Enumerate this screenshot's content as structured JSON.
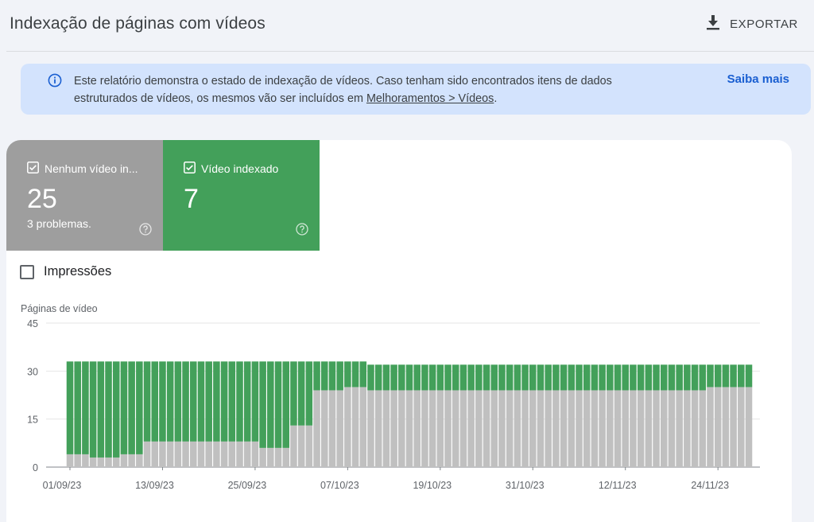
{
  "header": {
    "title": "Indexação de páginas com vídeos",
    "export_label": "EXPORTAR",
    "export_icon": "download-icon"
  },
  "info_banner": {
    "text_before": "Este relatório demonstra o estado de indexação de vídeos. Caso tenham sido encontrados itens de dados estruturados de vídeos, os mesmos vão ser incluídos em ",
    "link_text": "Melhoramentos > Vídeos",
    "text_after": ".",
    "learn_more": "Saiba mais",
    "icon": "info-icon"
  },
  "tiles": [
    {
      "label": "Nenhum vídeo in...",
      "value": "25",
      "subtext": "3 problemas.",
      "color": "#9e9e9e",
      "checked": true
    },
    {
      "label": "Vídeo indexado",
      "value": "7",
      "subtext": "",
      "color": "#43a05a",
      "checked": true
    }
  ],
  "impressions": {
    "label": "Impressões",
    "checked": false
  },
  "chart_data": {
    "type": "bar",
    "stacked": true,
    "ylabel": "Páginas de vídeo",
    "ylim": [
      0,
      45
    ],
    "yticks": [
      "0",
      "15",
      "30",
      "45"
    ],
    "x_tick_labels": [
      "01/09/23",
      "13/09/23",
      "25/09/23",
      "07/10/23",
      "19/10/23",
      "31/10/23",
      "12/11/23",
      "24/11/23"
    ],
    "x_tick_index": [
      0,
      12,
      24,
      36,
      48,
      60,
      72,
      84
    ],
    "categories_count": 88,
    "series": [
      {
        "name": "Nenhum vídeo in...",
        "color": "#c0c0c0",
        "values": [
          4,
          4,
          4,
          3,
          3,
          3,
          3,
          4,
          4,
          4,
          8,
          8,
          8,
          8,
          8,
          8,
          8,
          8,
          8,
          8,
          8,
          8,
          8,
          8,
          8,
          6,
          6,
          6,
          6,
          13,
          13,
          13,
          24,
          24,
          24,
          24,
          25,
          25,
          25,
          24,
          24,
          24,
          24,
          24,
          24,
          24,
          24,
          24,
          24,
          24,
          24,
          24,
          24,
          24,
          24,
          24,
          24,
          24,
          24,
          24,
          24,
          24,
          24,
          24,
          24,
          24,
          24,
          24,
          24,
          24,
          24,
          24,
          24,
          24,
          24,
          24,
          24,
          24,
          24,
          24,
          24,
          24,
          24,
          25,
          25,
          25,
          25,
          25,
          25
        ]
      },
      {
        "name": "Vídeo indexado",
        "color": "#43a05a",
        "values": [
          29,
          29,
          29,
          30,
          30,
          30,
          30,
          29,
          29,
          29,
          25,
          25,
          25,
          25,
          25,
          25,
          25,
          25,
          25,
          25,
          25,
          25,
          25,
          25,
          25,
          27,
          27,
          27,
          27,
          20,
          20,
          20,
          9,
          9,
          9,
          9,
          8,
          8,
          8,
          8,
          8,
          8,
          8,
          8,
          8,
          8,
          8,
          8,
          8,
          8,
          8,
          8,
          8,
          8,
          8,
          8,
          8,
          8,
          8,
          8,
          8,
          8,
          8,
          8,
          8,
          8,
          8,
          8,
          8,
          8,
          8,
          8,
          8,
          8,
          8,
          8,
          8,
          8,
          8,
          8,
          8,
          8,
          8,
          7,
          7,
          7,
          7,
          7,
          7
        ]
      }
    ],
    "grid": true
  }
}
